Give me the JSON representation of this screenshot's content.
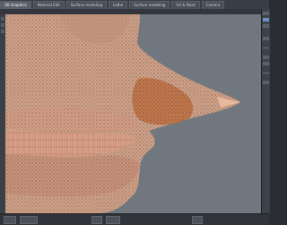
{
  "window": {
    "tabs": [
      {
        "label": "3D Graphics",
        "active": true
      },
      {
        "label": "Material Edit",
        "active": false
      },
      {
        "label": "Surface modeling",
        "active": false
      },
      {
        "label": "Lathe",
        "active": false
      },
      {
        "label": "Surface modeling",
        "active": false
      },
      {
        "label": "UV & Paint",
        "active": false
      },
      {
        "label": "Camera",
        "active": false
      }
    ]
  },
  "viewport": {
    "subject": "wireframe head mesh (nose, lips, teeth)"
  },
  "colors": {
    "background": "#70777f",
    "mesh_skin": "#d8a98d",
    "mesh_wire": "#3c2e2a",
    "selection": "#c9703a",
    "panel": "#3d4149"
  }
}
